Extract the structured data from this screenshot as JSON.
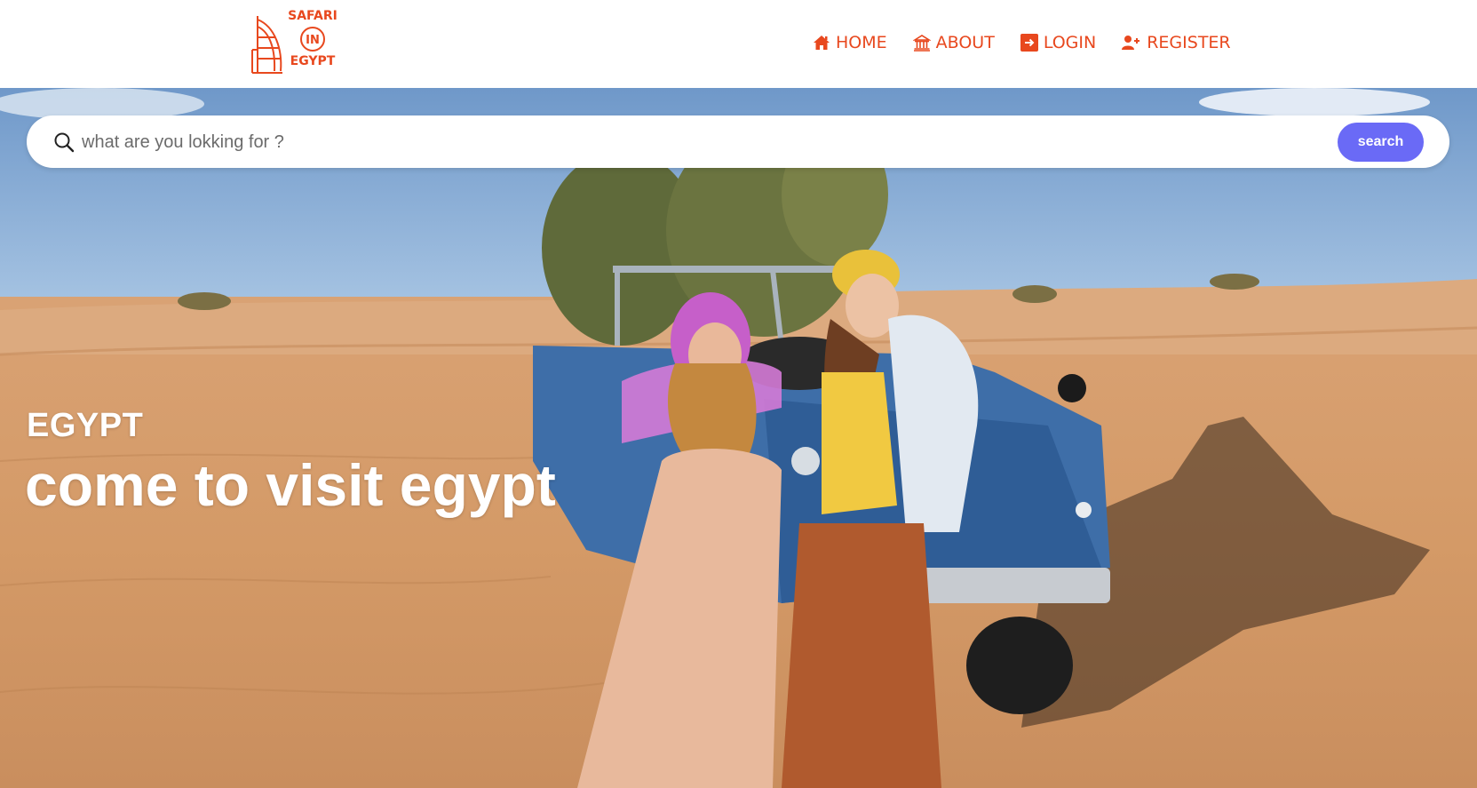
{
  "logo": {
    "line1": "SAFARI",
    "line2": "IN",
    "line3": "EGYPT",
    "icon": "burj-al-arab-icon"
  },
  "nav": {
    "items": [
      {
        "label": "HOME",
        "icon": "home-icon"
      },
      {
        "label": "ABOUT",
        "icon": "museum-icon"
      },
      {
        "label": "LOGIN",
        "icon": "login-icon"
      },
      {
        "label": "REGISTER",
        "icon": "add-user-icon"
      }
    ]
  },
  "search": {
    "placeholder": "what are you lokking for ?",
    "button_label": "search",
    "icon": "search-icon"
  },
  "hero": {
    "subtitle": "EGYPT",
    "title": "come to visit egypt"
  },
  "colors": {
    "brand": "#e8481e",
    "button": "#6a6af6",
    "text_on_image": "#ffffff"
  }
}
